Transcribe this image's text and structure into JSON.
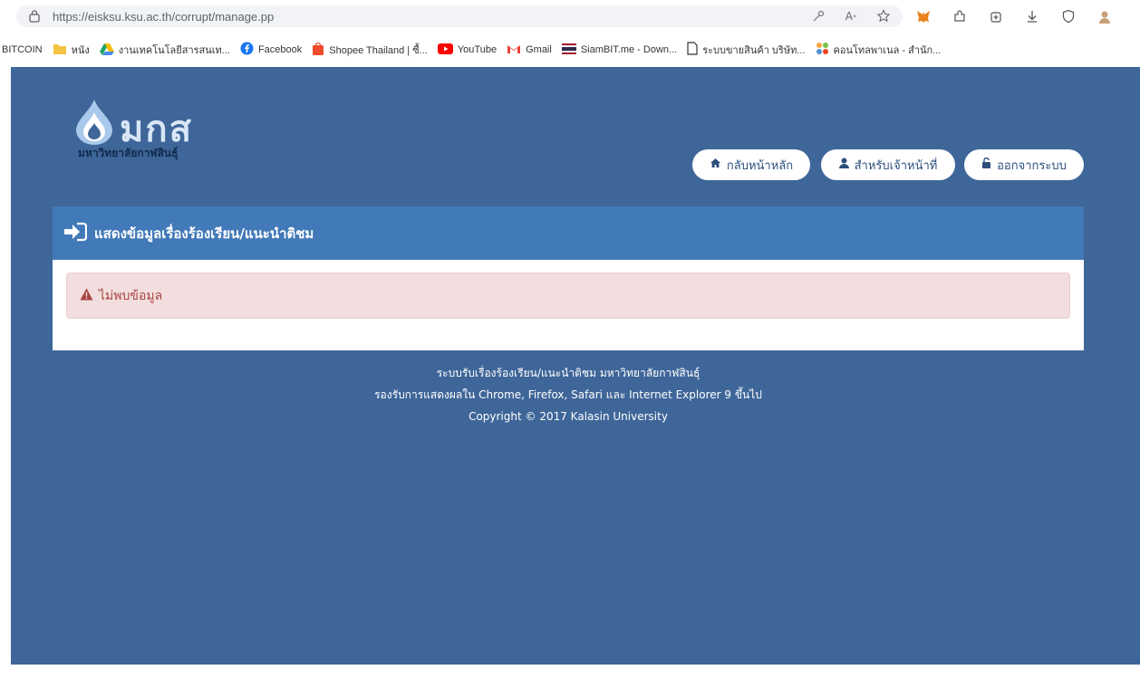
{
  "browser": {
    "url": "https://eisksu.ksu.ac.th/corrupt/manage.pp",
    "bookmarks": [
      {
        "label": "BITCOIN",
        "icon": "none"
      },
      {
        "label": "หนัง",
        "icon": "folder-icon"
      },
      {
        "label": "งานเทคโนโลยีสารสนเท...",
        "icon": "drive-icon"
      },
      {
        "label": "Facebook",
        "icon": "facebook-icon"
      },
      {
        "label": "Shopee Thailand | ซื้...",
        "icon": "shopee-icon"
      },
      {
        "label": "YouTube",
        "icon": "youtube-icon"
      },
      {
        "label": "Gmail",
        "icon": "gmail-icon"
      },
      {
        "label": "SiamBIT.me - Down...",
        "icon": "flag-icon"
      },
      {
        "label": "ระบบขายสินค้า บริษัท...",
        "icon": "page-icon"
      },
      {
        "label": "คอนโทลพาเนล - สำนัก...",
        "icon": "joomla-icon"
      }
    ]
  },
  "logo": {
    "main": "มกส",
    "sub": "มหาวิทยาลัยกาฬสินธุ์"
  },
  "nav": {
    "home": "กลับหน้าหลัก",
    "staff": "สำหรับเจ้าหน้าที่",
    "logout": "ออกจากระบบ"
  },
  "panel": {
    "title": "แสดงข้อมูลเรื่องร้องเรียน/แนะนำติชม",
    "alert": "ไม่พบข้อมูล"
  },
  "footer": {
    "line1": "ระบบรับเรื่องร้องเรียน/แนะนำติชม มหาวิทยาลัยกาฬสินธุ์",
    "line2": "รองรับการแสดงผลใน Chrome, Firefox, Safari และ Internet Explorer 9 ขึ้นไป",
    "line3": "Copyright © 2017 Kalasin University"
  },
  "colors": {
    "page_bg": "#3f6699",
    "panel_head": "#4279b8",
    "alert_bg": "#f2dede",
    "alert_text": "#a94442"
  }
}
